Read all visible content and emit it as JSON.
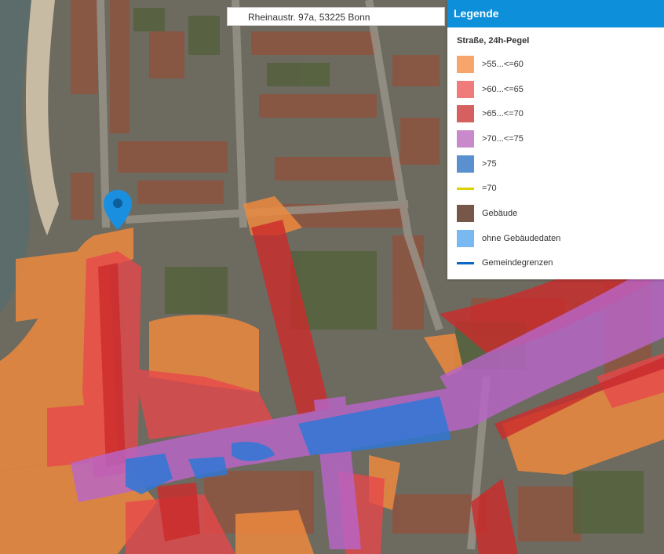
{
  "search": {
    "value": "Rheinaustr. 97a, 53225 Bonn"
  },
  "legend": {
    "title": "Legende",
    "subtitle": "Straße, 24h-Pegel",
    "items": [
      {
        "label": ">55...<=60",
        "color": "#f7a56b",
        "kind": "swatch"
      },
      {
        "label": ">60...<=65",
        "color": "#ef7b7b",
        "kind": "swatch"
      },
      {
        "label": ">65...<=70",
        "color": "#d6605f",
        "kind": "swatch"
      },
      {
        "label": ">70...<=75",
        "color": "#c98acb",
        "kind": "swatch"
      },
      {
        "label": ">75",
        "color": "#5b90cf",
        "kind": "swatch"
      },
      {
        "label": "=70",
        "color": "#d9d400",
        "kind": "line"
      },
      {
        "label": "Gebäude",
        "color": "#76574a",
        "kind": "swatch"
      },
      {
        "label": "ohne Gebäudedaten",
        "color": "#7ab8f2",
        "kind": "swatch"
      },
      {
        "label": "Gemeindegrenzen",
        "color": "#0a67c4",
        "kind": "line"
      }
    ]
  },
  "marker": {
    "name": "location-pin-icon",
    "color": "#1a8fe0"
  },
  "colors": {
    "river": "#5c6e6e",
    "roof": "#8b5a44",
    "vegetation": "#5f6b43",
    "noise_55_60": "#f28a3d",
    "noise_60_65": "#e8474a",
    "noise_65_70": "#cc2b2b",
    "noise_70_75": "#b865c8",
    "noise_over_75": "#2f78d6"
  }
}
